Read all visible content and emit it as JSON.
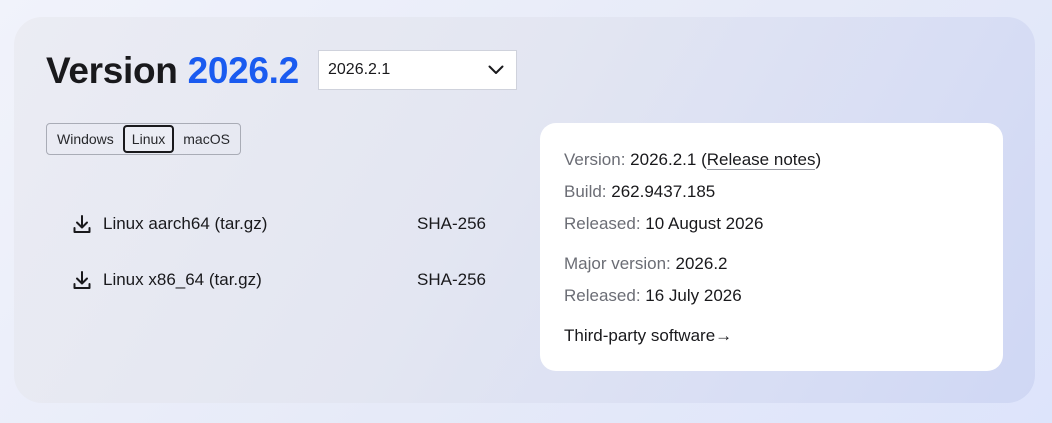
{
  "header": {
    "title_prefix": "Version",
    "title_version": "2026.2",
    "selected_version": "2026.2.1"
  },
  "os_tabs": {
    "items": [
      "Windows",
      "Linux",
      "macOS"
    ],
    "active": "Linux"
  },
  "downloads": [
    {
      "label": "Linux aarch64 (tar.gz)",
      "checksum": "SHA-256"
    },
    {
      "label": "Linux x86_64 (tar.gz)",
      "checksum": "SHA-256"
    }
  ],
  "info": {
    "version_label": "Version:",
    "version_value": "2026.2.1",
    "paren_open": "(",
    "release_notes": "Release notes",
    "paren_close": ")",
    "build_label": "Build:",
    "build_value": "262.9437.185",
    "released_label": "Released:",
    "released_value": "10 August 2026",
    "major_label": "Major version:",
    "major_value": "2026.2",
    "major_released_label": "Released:",
    "major_released_value": "16 July 2026",
    "third_party": "Third-party software",
    "third_party_arrow": "→"
  },
  "colors": {
    "accent": "#1a5bf0",
    "text": "#19191c",
    "muted": "#6b6d75"
  }
}
